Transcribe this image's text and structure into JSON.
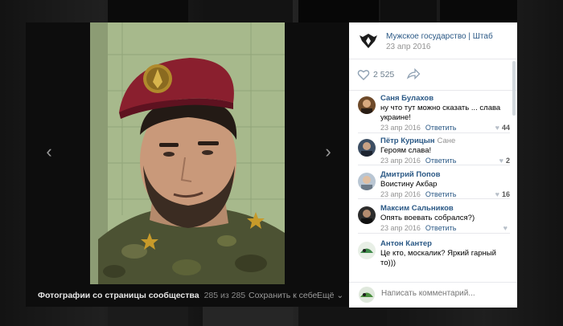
{
  "viewer": {
    "footer_title": "Фотографии со страницы сообщества",
    "footer_count": "285 из 285",
    "save_label": "Сохранить к себе",
    "more_label": "Ещё ⌄",
    "prev_icon": "chevron-left-icon",
    "next_icon": "chevron-right-icon"
  },
  "post": {
    "group_name": "Мужское государство | Штаб",
    "date": "23 апр 2016",
    "likes": "2 525"
  },
  "comments": [
    {
      "author": "Саня Булахов",
      "reply_to": "",
      "text": "ну что тут можно сказать ... слава украине!",
      "date": "23 апр 2016",
      "reply": "Ответить",
      "likes": "44"
    },
    {
      "author": "Пётр Курицын",
      "reply_to": "Сане",
      "text": "Героям слава!",
      "date": "23 апр 2016",
      "reply": "Ответить",
      "likes": "2"
    },
    {
      "author": "Дмитрий Попов",
      "reply_to": "",
      "text": "Воистину Акбар",
      "date": "23 апр 2016",
      "reply": "Ответить",
      "likes": "16"
    },
    {
      "author": "Максим Сальников",
      "reply_to": "",
      "text": "Опять воевать собрался?)",
      "date": "23 апр 2016",
      "reply": "Ответить",
      "likes": ""
    },
    {
      "author": "Антон Кантер",
      "reply_to": "",
      "text": "Це кто, москалик? Яркий гарный то)))",
      "date": "",
      "reply": "",
      "likes": ""
    }
  ],
  "comment_form": {
    "placeholder": "Написать комментарий..."
  },
  "colors": {
    "link": "#2a5885",
    "muted": "#939393",
    "beret": "#8a1f2e"
  }
}
